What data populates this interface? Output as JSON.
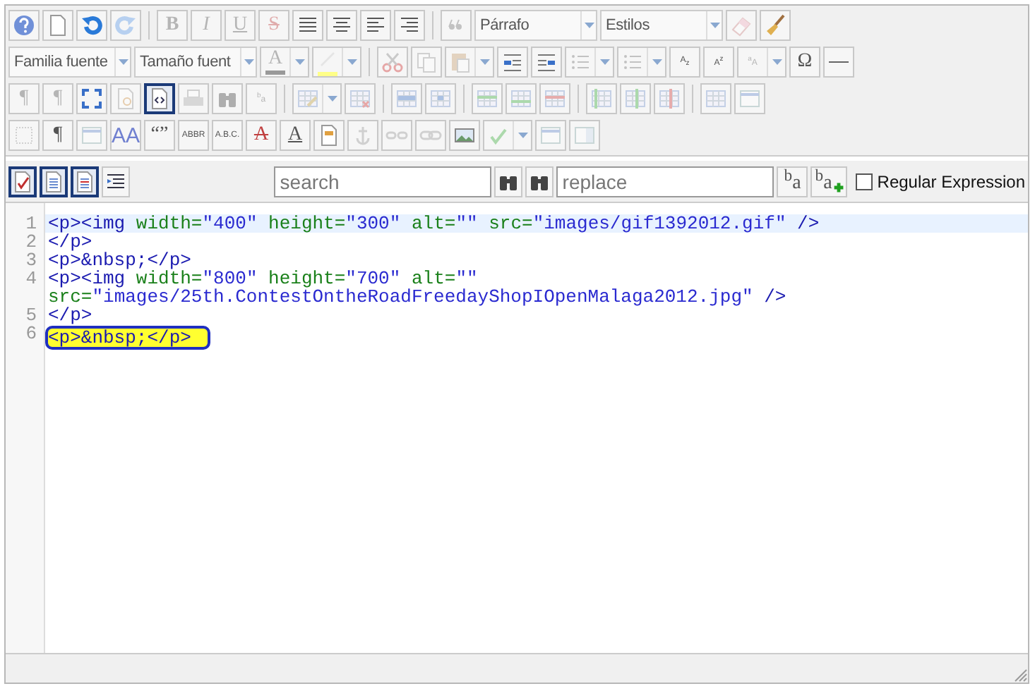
{
  "toolbar": {
    "rows": [
      {
        "items": [
          {
            "kind": "button",
            "disabled": false
          },
          {
            "kind": "button",
            "disabled": false
          },
          {
            "kind": "button",
            "disabled": false
          },
          {
            "kind": "button",
            "disabled": true
          },
          {
            "kind": "sep"
          },
          {
            "kind": "bold",
            "label": "B",
            "disabled": true
          },
          {
            "kind": "italic",
            "label": "I",
            "disabled": true
          },
          {
            "kind": "underline",
            "label": "U",
            "disabled": true
          },
          {
            "kind": "strike",
            "label": "S",
            "disabled": true
          },
          {
            "kind": "button",
            "disabled": false
          },
          {
            "kind": "button",
            "disabled": false
          },
          {
            "kind": "button",
            "disabled": false
          },
          {
            "kind": "button",
            "disabled": false
          },
          {
            "kind": "sep"
          },
          {
            "kind": "button",
            "disabled": true
          },
          {
            "kind": "select",
            "value": "Párrafo",
            "disabled": false
          },
          {
            "kind": "select",
            "value": "Estilos",
            "disabled": false
          },
          {
            "kind": "button",
            "disabled": true
          },
          {
            "kind": "button",
            "disabled": false
          }
        ]
      },
      {
        "items": [
          {
            "kind": "select",
            "value": "Familia fuente",
            "disabled": false
          },
          {
            "kind": "select",
            "value": "Tamaño fuent",
            "disabled": false
          },
          {
            "kind": "split",
            "label": "A",
            "color": "#999999",
            "disabled": true
          },
          {
            "kind": "split",
            "color": "#ffff88",
            "disabled": true
          },
          {
            "kind": "sep"
          },
          {
            "kind": "button",
            "disabled": true
          },
          {
            "kind": "button",
            "disabled": true
          },
          {
            "kind": "split",
            "disabled": true
          },
          {
            "kind": "button",
            "disabled": false
          },
          {
            "kind": "button",
            "disabled": false
          },
          {
            "kind": "split",
            "disabled": true
          },
          {
            "kind": "split",
            "disabled": true
          },
          {
            "kind": "button",
            "label": "A$_{z}$",
            "disabled": false
          },
          {
            "kind": "button",
            "label": "A$^{z}$",
            "disabled": false
          },
          {
            "kind": "split",
            "label": "$^{a}$A",
            "disabled": true
          },
          {
            "kind": "button",
            "label": "Ω",
            "disabled": false
          },
          {
            "kind": "button",
            "disabled": false
          }
        ]
      },
      {
        "items": [
          {
            "kind": "button",
            "label": "¶",
            "disabled": true
          },
          {
            "kind": "button",
            "label": "¶",
            "disabled": true
          },
          {
            "kind": "button",
            "disabled": false,
            "selected": false
          },
          {
            "kind": "button",
            "disabled": true
          },
          {
            "kind": "button",
            "disabled": false,
            "selected": true
          },
          {
            "kind": "button",
            "disabled": true
          },
          {
            "kind": "button",
            "disabled": true
          },
          {
            "kind": "button",
            "label": "$^{b}$a",
            "disabled": true
          },
          {
            "kind": "sep"
          },
          {
            "kind": "split",
            "disabled": true
          },
          {
            "kind": "button",
            "disabled": true
          },
          {
            "kind": "sep"
          },
          {
            "kind": "button",
            "disabled": true
          },
          {
            "kind": "button",
            "disabled": true
          },
          {
            "kind": "sep"
          },
          {
            "kind": "button",
            "disabled": true
          },
          {
            "kind": "button",
            "disabled": true
          },
          {
            "kind": "button",
            "disabled": true
          },
          {
            "kind": "sep"
          },
          {
            "kind": "button",
            "disabled": true
          },
          {
            "kind": "button",
            "disabled": true
          },
          {
            "kind": "button",
            "disabled": true
          },
          {
            "kind": "sep"
          },
          {
            "kind": "button",
            "disabled": true
          },
          {
            "kind": "button",
            "disabled": true
          }
        ]
      },
      {
        "items": [
          {
            "kind": "button",
            "disabled": true,
            "selected": false
          },
          {
            "kind": "button",
            "label": "¶",
            "disabled": false,
            "selected": false
          },
          {
            "kind": "button",
            "disabled": true
          },
          {
            "kind": "styles",
            "label": "AA",
            "disabled": false
          },
          {
            "kind": "button",
            "label": "“”",
            "disabled": false
          },
          {
            "kind": "button",
            "label": "ABBR",
            "disabled": false
          },
          {
            "kind": "button",
            "label": "A.B.C.",
            "disabled": false
          },
          {
            "kind": "strike",
            "label": "A",
            "disabled": false
          },
          {
            "kind": "underline",
            "label": "A",
            "disabled": false
          },
          {
            "kind": "button",
            "disabled": false
          },
          {
            "kind": "button",
            "disabled": true
          },
          {
            "kind": "button",
            "disabled": true
          },
          {
            "kind": "button",
            "disabled": true
          },
          {
            "kind": "button",
            "disabled": false
          },
          {
            "kind": "split",
            "disabled": true
          },
          {
            "kind": "button",
            "disabled": true
          },
          {
            "kind": "button",
            "disabled": true
          }
        ]
      }
    ]
  },
  "find_bar": {
    "toggles": [
      {
        "selected": true
      },
      {
        "selected": true
      },
      {
        "selected": true
      },
      {
        "selected": false
      }
    ],
    "search": {
      "placeholder": "search"
    },
    "replace": {
      "placeholder": "replace"
    },
    "replace_buttons": [
      {
        "label": "$^{b}$a",
        "kind": "one"
      },
      {
        "label": "$^{b}$a",
        "kind": "all"
      }
    ],
    "regex": {
      "label": "Regular Expression",
      "checked": false
    }
  },
  "editor": {
    "lines": [
      {
        "number": "1",
        "active": true,
        "highlighted": false,
        "tokens": [
          {
            "kind": "tag",
            "text": "<p><img "
          },
          {
            "kind": "attr",
            "text": "width="
          },
          {
            "kind": "value",
            "text": "\"400\" "
          },
          {
            "kind": "attr",
            "text": "height="
          },
          {
            "kind": "value",
            "text": "\"300\" "
          },
          {
            "kind": "attr",
            "text": "alt="
          },
          {
            "kind": "value",
            "text": "\"\" "
          },
          {
            "kind": "attr",
            "text": "src="
          },
          {
            "kind": "value",
            "text": "\"images/gif1392012.gif\" "
          },
          {
            "kind": "tag",
            "text": "/>"
          }
        ]
      },
      {
        "number": "2",
        "active": false,
        "highlighted": false,
        "tokens": [
          {
            "kind": "tag",
            "text": "</p>"
          }
        ]
      },
      {
        "number": "3",
        "active": false,
        "highlighted": false,
        "tokens": [
          {
            "kind": "tag",
            "text": "<p>"
          },
          {
            "kind": "text",
            "text": "&nbsp;"
          },
          {
            "kind": "tag",
            "text": "</p>"
          }
        ]
      },
      {
        "number": "4",
        "active": false,
        "highlighted": false,
        "tokens": [
          {
            "kind": "tag",
            "text": "<p><img "
          },
          {
            "kind": "attr",
            "text": "width="
          },
          {
            "kind": "value",
            "text": "\"800\" "
          },
          {
            "kind": "attr",
            "text": "height="
          },
          {
            "kind": "value",
            "text": "\"700\" "
          },
          {
            "kind": "attr",
            "text": "alt="
          },
          {
            "kind": "value",
            "text": "\"\" "
          },
          {
            "kind": "attr",
            "text": "src="
          },
          {
            "kind": "value",
            "text": "\"images/25th.ContestOntheRoadFreedayShopIOpenMalaga2012.jpg\" "
          },
          {
            "kind": "tag",
            "text": "/>"
          }
        ]
      },
      {
        "number": "5",
        "active": false,
        "highlighted": false,
        "tokens": [
          {
            "kind": "tag",
            "text": "</p>"
          }
        ]
      },
      {
        "number": "6",
        "active": false,
        "highlighted": true,
        "tokens": [
          {
            "kind": "tag",
            "text": "<p>"
          },
          {
            "kind": "text",
            "text": "&nbsp;"
          },
          {
            "kind": "tag",
            "text": "</p>"
          }
        ]
      }
    ]
  }
}
